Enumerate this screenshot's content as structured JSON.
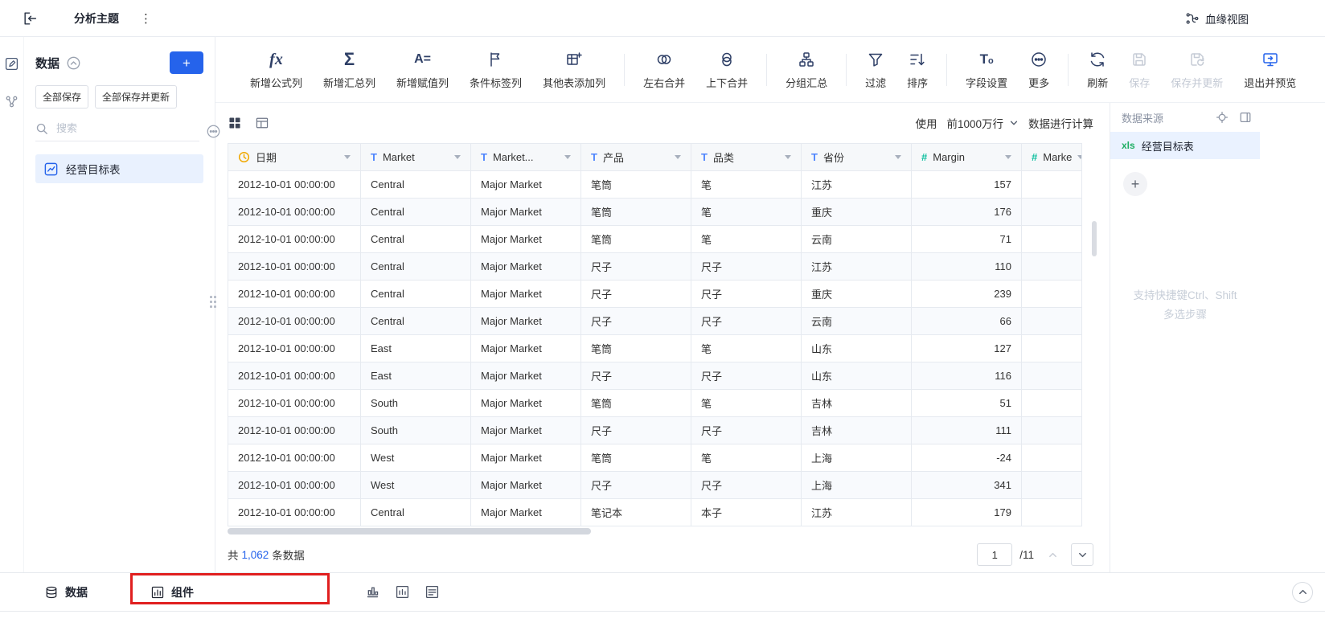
{
  "topbar": {
    "title": "分析主题",
    "lineage_label": "血缘视图"
  },
  "data_panel": {
    "title": "数据",
    "add_label": "+",
    "save_all": "全部保存",
    "save_all_update": "全部保存并更新",
    "search_placeholder": "搜索",
    "tables": [
      {
        "name": "经营目标表"
      }
    ]
  },
  "toolbar": {
    "items": [
      {
        "icon": "formula-fx-icon",
        "label": "新增公式列"
      },
      {
        "icon": "sigma-icon",
        "label": "新增汇总列"
      },
      {
        "icon": "assign-icon",
        "label": "新增赋值列"
      },
      {
        "icon": "conditional-tag-icon",
        "label": "条件标签列"
      },
      {
        "icon": "other-table-column-icon",
        "label": "其他表添加列"
      },
      {
        "icon": "merge-lr-icon",
        "label": "左右合并"
      },
      {
        "icon": "merge-tb-icon",
        "label": "上下合并"
      },
      {
        "icon": "group-summary-icon",
        "label": "分组汇总"
      },
      {
        "icon": "filter-icon",
        "label": "过滤"
      },
      {
        "icon": "sort-icon",
        "label": "排序"
      },
      {
        "icon": "field-settings-icon",
        "label": "字段设置"
      },
      {
        "icon": "more-icon",
        "label": "更多"
      },
      {
        "icon": "refresh-icon",
        "label": "刷新"
      },
      {
        "icon": "save-icon",
        "label": "保存",
        "disabled": true
      },
      {
        "icon": "save-update-icon",
        "label": "保存并更新",
        "disabled": true
      },
      {
        "icon": "exit-preview-icon",
        "label": "退出并预览"
      }
    ]
  },
  "usage_bar": {
    "use": "使用",
    "rows_option": "前1000万行",
    "compute": "数据进行计算"
  },
  "table": {
    "columns": [
      {
        "name": "日期",
        "type": "date"
      },
      {
        "name": "Market",
        "type": "text"
      },
      {
        "name": "Market...",
        "type": "text"
      },
      {
        "name": "产品",
        "type": "text"
      },
      {
        "name": "品类",
        "type": "text"
      },
      {
        "name": "省份",
        "type": "text"
      },
      {
        "name": "Margin",
        "type": "number"
      },
      {
        "name": "Marke",
        "type": "number"
      }
    ],
    "rows": [
      [
        "2012-10-01 00:00:00",
        "Central",
        "Major Market",
        "笔筒",
        "笔",
        "江苏",
        157,
        ""
      ],
      [
        "2012-10-01 00:00:00",
        "Central",
        "Major Market",
        "笔筒",
        "笔",
        "重庆",
        176,
        ""
      ],
      [
        "2012-10-01 00:00:00",
        "Central",
        "Major Market",
        "笔筒",
        "笔",
        "云南",
        71,
        ""
      ],
      [
        "2012-10-01 00:00:00",
        "Central",
        "Major Market",
        "尺子",
        "尺子",
        "江苏",
        110,
        ""
      ],
      [
        "2012-10-01 00:00:00",
        "Central",
        "Major Market",
        "尺子",
        "尺子",
        "重庆",
        239,
        ""
      ],
      [
        "2012-10-01 00:00:00",
        "Central",
        "Major Market",
        "尺子",
        "尺子",
        "云南",
        66,
        ""
      ],
      [
        "2012-10-01 00:00:00",
        "East",
        "Major Market",
        "笔筒",
        "笔",
        "山东",
        127,
        ""
      ],
      [
        "2012-10-01 00:00:00",
        "East",
        "Major Market",
        "尺子",
        "尺子",
        "山东",
        116,
        ""
      ],
      [
        "2012-10-01 00:00:00",
        "South",
        "Major Market",
        "笔筒",
        "笔",
        "吉林",
        51,
        ""
      ],
      [
        "2012-10-01 00:00:00",
        "South",
        "Major Market",
        "尺子",
        "尺子",
        "吉林",
        111,
        ""
      ],
      [
        "2012-10-01 00:00:00",
        "West",
        "Major Market",
        "笔筒",
        "笔",
        "上海",
        -24,
        ""
      ],
      [
        "2012-10-01 00:00:00",
        "West",
        "Major Market",
        "尺子",
        "尺子",
        "上海",
        341,
        ""
      ],
      [
        "2012-10-01 00:00:00",
        "Central",
        "Major Market",
        "笔记本",
        "本子",
        "江苏",
        179,
        ""
      ]
    ]
  },
  "table_footer": {
    "total_prefix": "共",
    "total_count": "1,062",
    "total_suffix": "条数据",
    "page": "1",
    "page_total": "/11"
  },
  "right_panel": {
    "title": "数据来源",
    "source": {
      "badge": "xls",
      "name": "经营目标表"
    },
    "add_label": "+",
    "hint_line1": "支持快捷键Ctrl、Shift",
    "hint_line2": "多选步骤"
  },
  "bottom_bar": {
    "tab_data": "数据",
    "tab_component": "组件"
  },
  "colors": {
    "accent": "#2563eb",
    "field_text": "#4e85fd",
    "field_number": "#0fbf9f",
    "field_date": "#f0a800",
    "xls_green": "#1fae63",
    "selected_bg": "#eaf2ff",
    "annotation_red": "#e01f1f"
  }
}
